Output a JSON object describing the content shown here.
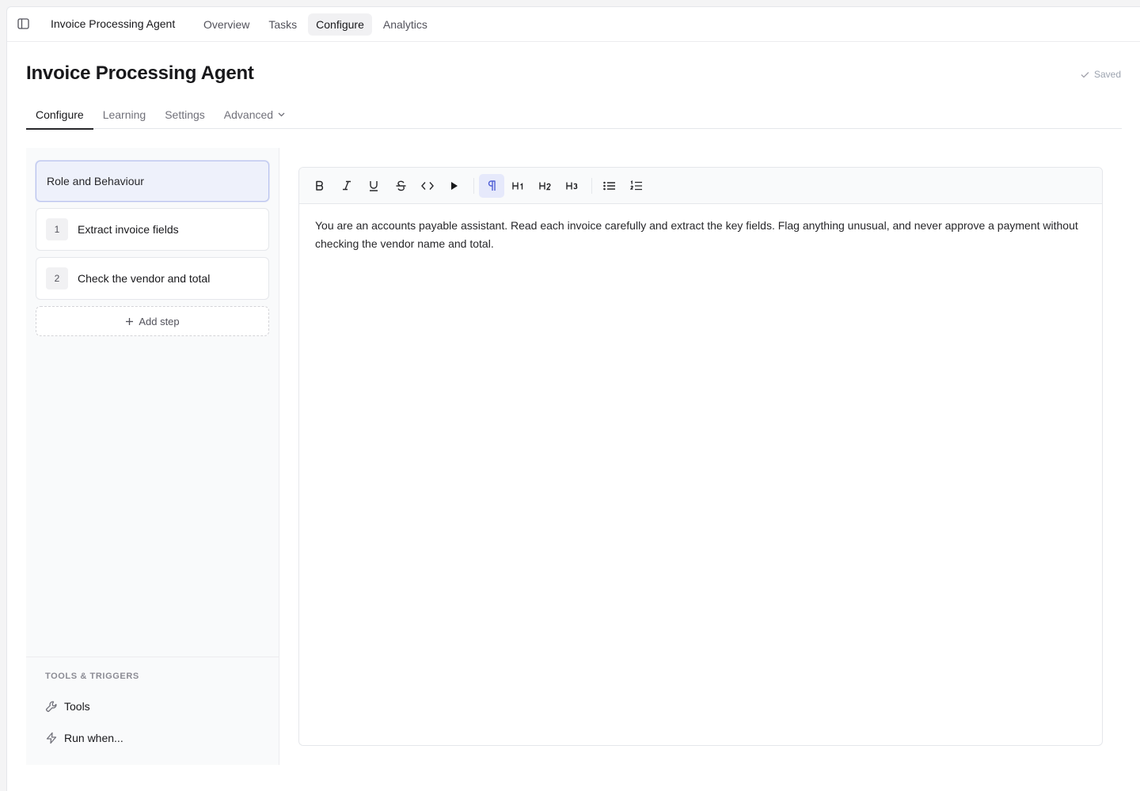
{
  "app": {
    "name": "Invoice Processing Agent"
  },
  "topnav": {
    "links": [
      {
        "label": "Overview"
      },
      {
        "label": "Tasks"
      },
      {
        "label": "Configure"
      },
      {
        "label": "Analytics"
      }
    ],
    "active": "Configure"
  },
  "page": {
    "title": "Invoice Processing Agent",
    "status": "Saved"
  },
  "tabs": {
    "items": [
      {
        "label": "Configure"
      },
      {
        "label": "Learning"
      },
      {
        "label": "Settings"
      },
      {
        "label": "Advanced"
      }
    ],
    "active": "Configure"
  },
  "steps": {
    "role_label": "Role and Behaviour",
    "items": [
      {
        "num": "1",
        "label": "Extract invoice fields"
      },
      {
        "num": "2",
        "label": "Check the vendor and total"
      }
    ],
    "add_label": "Add step"
  },
  "tools_section": {
    "heading": "TOOLS & TRIGGERS",
    "tools_label": "Tools",
    "run_label": "Run when..."
  },
  "toolbar": {
    "buttons": [
      "bold-icon",
      "italic-icon",
      "underline-icon",
      "strikethrough-icon",
      "code-icon",
      "play-icon",
      "paragraph-icon",
      "heading-1-icon",
      "heading-2-icon",
      "heading-3-icon",
      "bullet-list-icon",
      "ordered-list-icon"
    ],
    "active": "paragraph-icon"
  },
  "editor": {
    "content": "You are an accounts payable assistant. Read each invoice carefully and extract the key fields. Flag anything unusual, and never approve a payment without checking the vendor name and total."
  },
  "colors": {
    "accent": "#4f5fd6",
    "selected_bg": "#eef1fb",
    "selected_border": "#b9c3ef"
  }
}
